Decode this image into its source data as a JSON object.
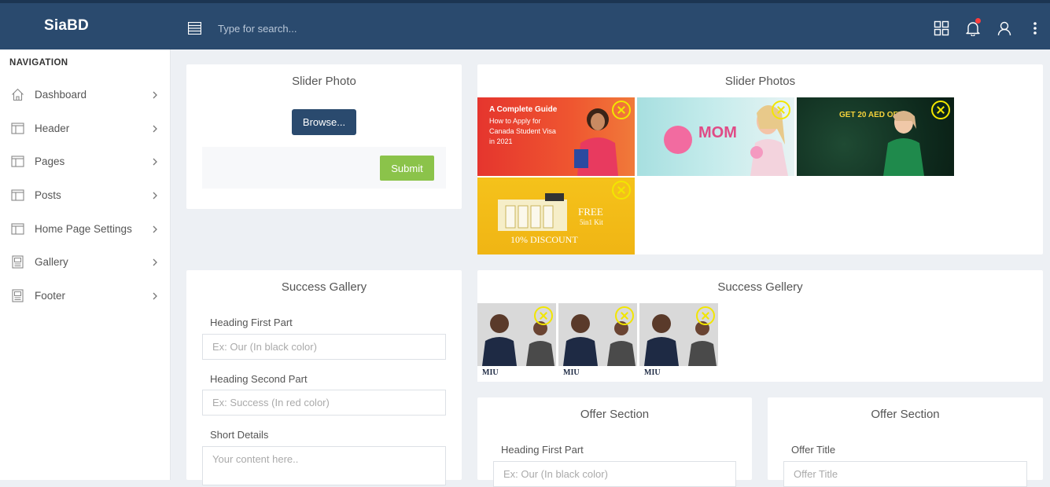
{
  "topbar": {
    "brand": "SiaBD",
    "search_placeholder": "Type for search...",
    "icons": [
      "menu-icon",
      "apps-grid-icon",
      "bell-icon",
      "user-icon",
      "more-vertical-icon"
    ],
    "notification_color": "#ff3d3d",
    "bg_color": "#2a4a6e"
  },
  "sidebar": {
    "title": "NAVIGATION",
    "items": [
      {
        "label": "Dashboard",
        "icon": "home-icon"
      },
      {
        "label": "Header",
        "icon": "layout-icon"
      },
      {
        "label": "Pages",
        "icon": "layout-icon"
      },
      {
        "label": "Posts",
        "icon": "layout-icon"
      },
      {
        "label": "Home Page Settings",
        "icon": "layout-icon"
      },
      {
        "label": "Gallery",
        "icon": "gallery-icon"
      },
      {
        "label": "Footer",
        "icon": "gallery-icon"
      }
    ]
  },
  "slider_form": {
    "title": "Slider Photo",
    "browse_label": "Browse...",
    "submit_label": "Submit"
  },
  "slider_photos": {
    "title": "Slider Photos",
    "photos": [
      {
        "name": "canada-visa-guide",
        "lines": [
          "A Complete Guide",
          "How to Apply for",
          "Canada Student Visa",
          "in 2021"
        ]
      },
      {
        "name": "mothers-day-banner",
        "lines": [
          "MOM"
        ]
      },
      {
        "name": "aed-offer-banner",
        "lines": [
          "GET 20 AED OFF"
        ]
      },
      {
        "name": "discount-kit-banner",
        "lines": [
          "FREE",
          "5in1 Kit",
          "10% DISCOUNT"
        ]
      }
    ]
  },
  "success_gallery_form": {
    "title": "Success Gallery",
    "fields": [
      {
        "label": "Heading First Part",
        "placeholder": "Ex: Our (In black color)"
      },
      {
        "label": "Heading Second Part",
        "placeholder": "Ex: Success (In red color)"
      },
      {
        "label": "Short Details",
        "placeholder": "Your content here.."
      }
    ]
  },
  "success_gallery_list": {
    "title": "Success Gellery",
    "photos": [
      {
        "name": "success-photo-1",
        "brand": "MIU"
      },
      {
        "name": "success-photo-2",
        "brand": "MIU"
      },
      {
        "name": "success-photo-3",
        "brand": "MIU"
      }
    ]
  },
  "offer_left": {
    "title": "Offer Section",
    "field_label": "Heading First Part",
    "field_placeholder": "Ex: Our (In black color)"
  },
  "offer_right": {
    "title": "Offer Section",
    "field_label": "Offer Title",
    "field_placeholder": "Offer Title"
  },
  "colors": {
    "accent": "#2a4a6e",
    "submit": "#8bc34a",
    "remove_ring": "#f2e600",
    "page_bg": "#edf0f4"
  }
}
